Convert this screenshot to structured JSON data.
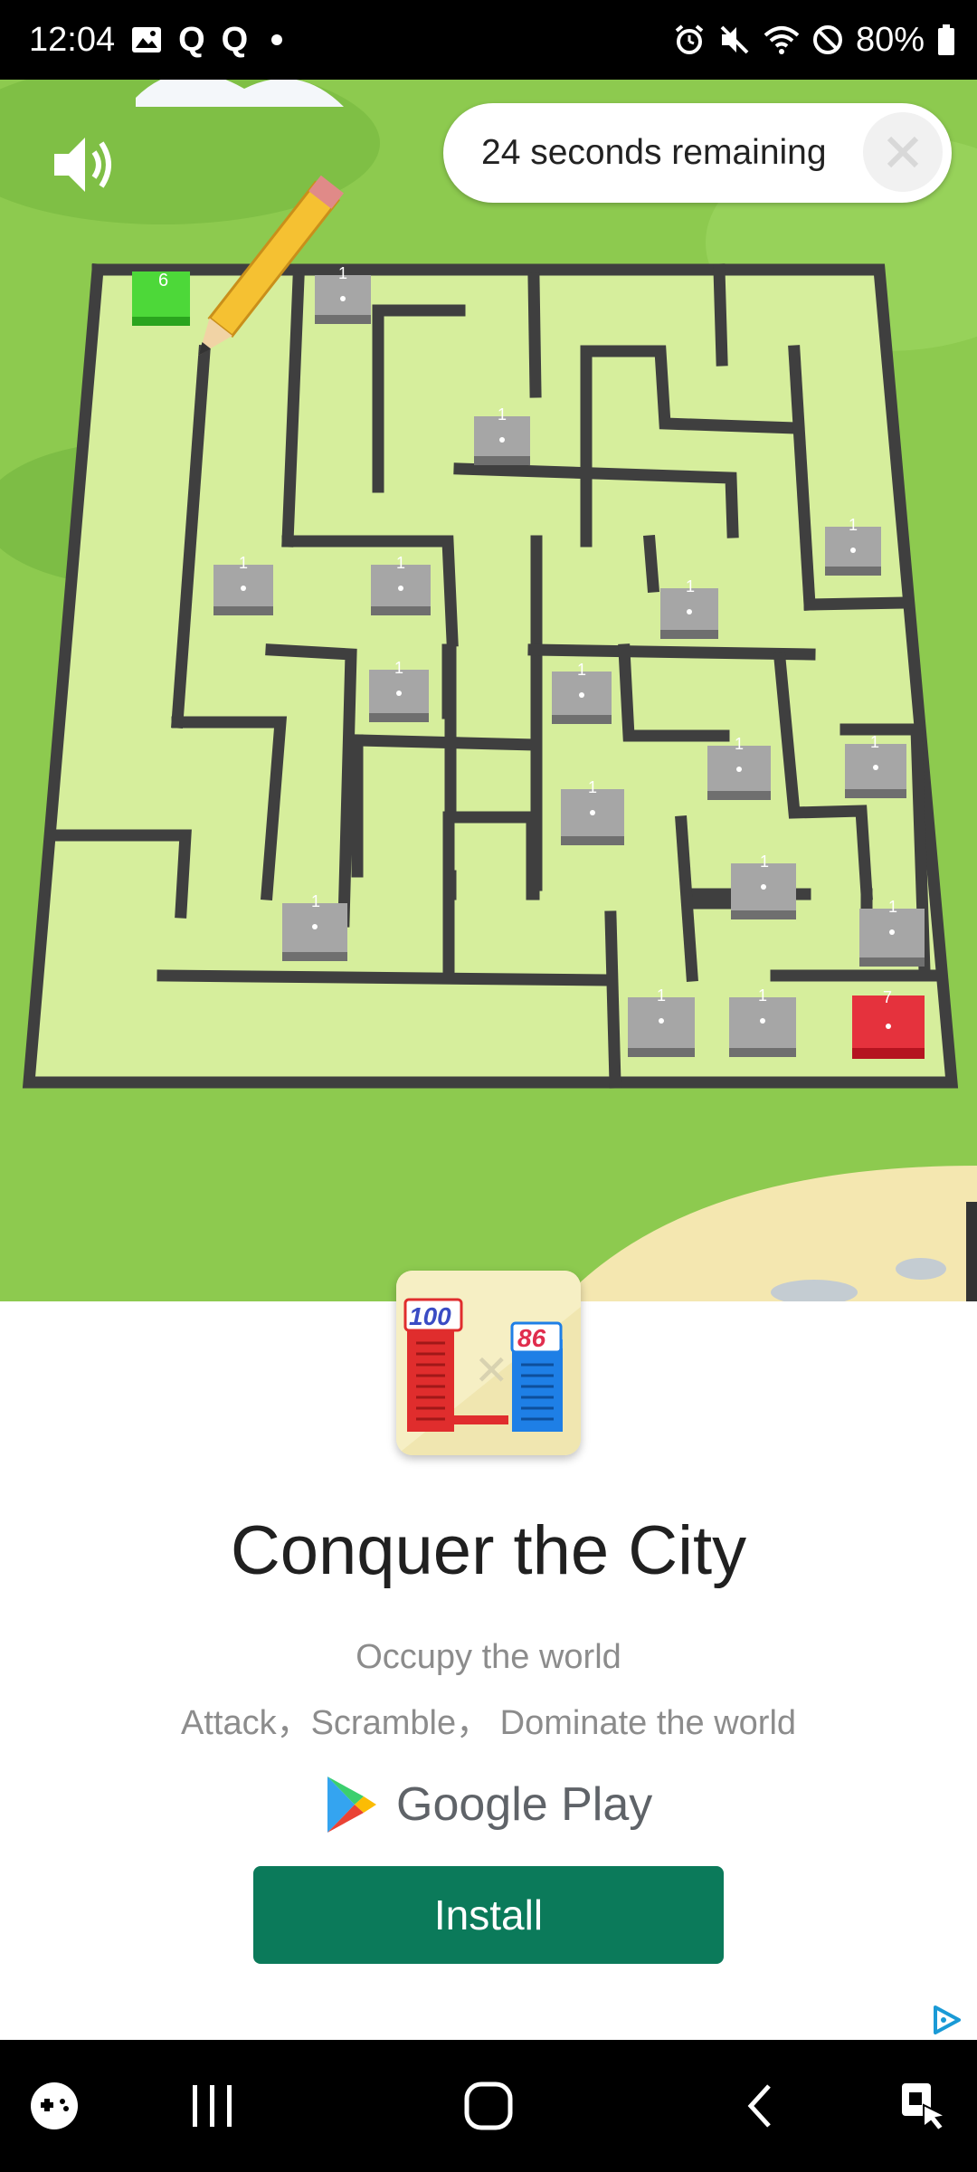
{
  "status_bar": {
    "time": "12:04",
    "q1": "Q",
    "q2": "Q",
    "battery": "80%",
    "icons": [
      "gallery-icon",
      "alarm-icon",
      "mute-icon",
      "wifi-icon",
      "do-not-disturb-icon",
      "battery-icon"
    ]
  },
  "ad": {
    "timer_text": "24 seconds remaining",
    "close_icon": "close-icon",
    "sound_icon": "speaker-icon",
    "maze": {
      "green_count": "6",
      "red_count": "7",
      "gray_count": "1"
    },
    "app_icon_numbers": {
      "left": "100",
      "right": "86"
    },
    "title": "Conquer the City",
    "subtitle_1": "Occupy the world",
    "subtitle_2": "Attack，Scramble， Dominate the world",
    "store_label": "Google Play",
    "install_label": "Install",
    "install_color": "#0b7a5a"
  },
  "nav_bar": {
    "icons": [
      "game-launcher-icon",
      "recent-apps-icon",
      "home-icon",
      "back-icon",
      "accessibility-icon"
    ]
  }
}
